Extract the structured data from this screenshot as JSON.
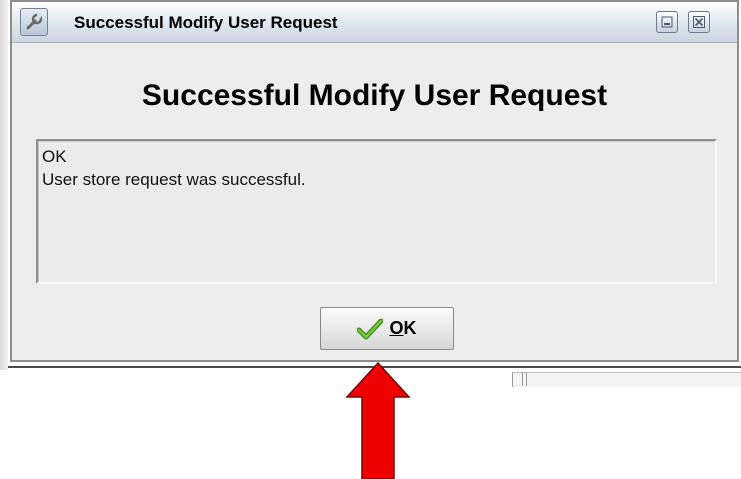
{
  "window": {
    "title": "Successful Modify User Request",
    "icon": "wrench-icon",
    "controls": [
      "minimize-icon",
      "close-icon"
    ]
  },
  "dialog": {
    "heading": "Successful Modify User Request",
    "messages": [
      "OK",
      "User store request was successful."
    ],
    "ok_button": {
      "icon": "checkmark-icon",
      "label_mnemonic": "O",
      "label_rest": "K"
    }
  },
  "annotation": {
    "arrow_color": "#ee0000",
    "arrow_outline": "#7a0000",
    "points_to": "ok-button"
  }
}
